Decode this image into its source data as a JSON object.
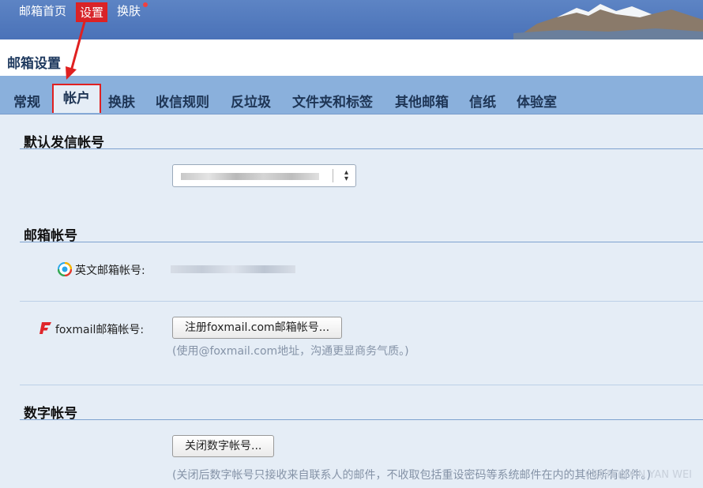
{
  "topnav": {
    "home": "邮箱首页",
    "settings": "设置",
    "skin": "换肤"
  },
  "page_title": "邮箱设置",
  "tabs": [
    "常规",
    "帐户",
    "换肤",
    "收信规则",
    "反垃圾",
    "文件夹和标签",
    "其他邮箱",
    "信纸",
    "体验室"
  ],
  "sections": {
    "default_sender": {
      "title": "默认发信帐号"
    },
    "mail_accounts": {
      "title": "邮箱帐号",
      "english_label": "英文邮箱帐号:",
      "foxmail_label": "foxmail邮箱帐号:",
      "foxmail_button": "注册foxmail.com邮箱帐号...",
      "foxmail_hint": "(使用@foxmail.com地址，沟通更显商务气质。)"
    },
    "digital": {
      "title": "数字帐号",
      "button": "关闭数字帐号...",
      "hint": "(关闭后数字帐号只接收来自联系人的邮件，不收取包括重设密码等系统邮件在内的其他所有邮件。)"
    }
  },
  "watermark": "CSDN @XIN YAN WEI",
  "colors": {
    "accent_red": "#e02020",
    "tab_bar": "#8ab0dc",
    "top_bar": "#4a72b8"
  }
}
